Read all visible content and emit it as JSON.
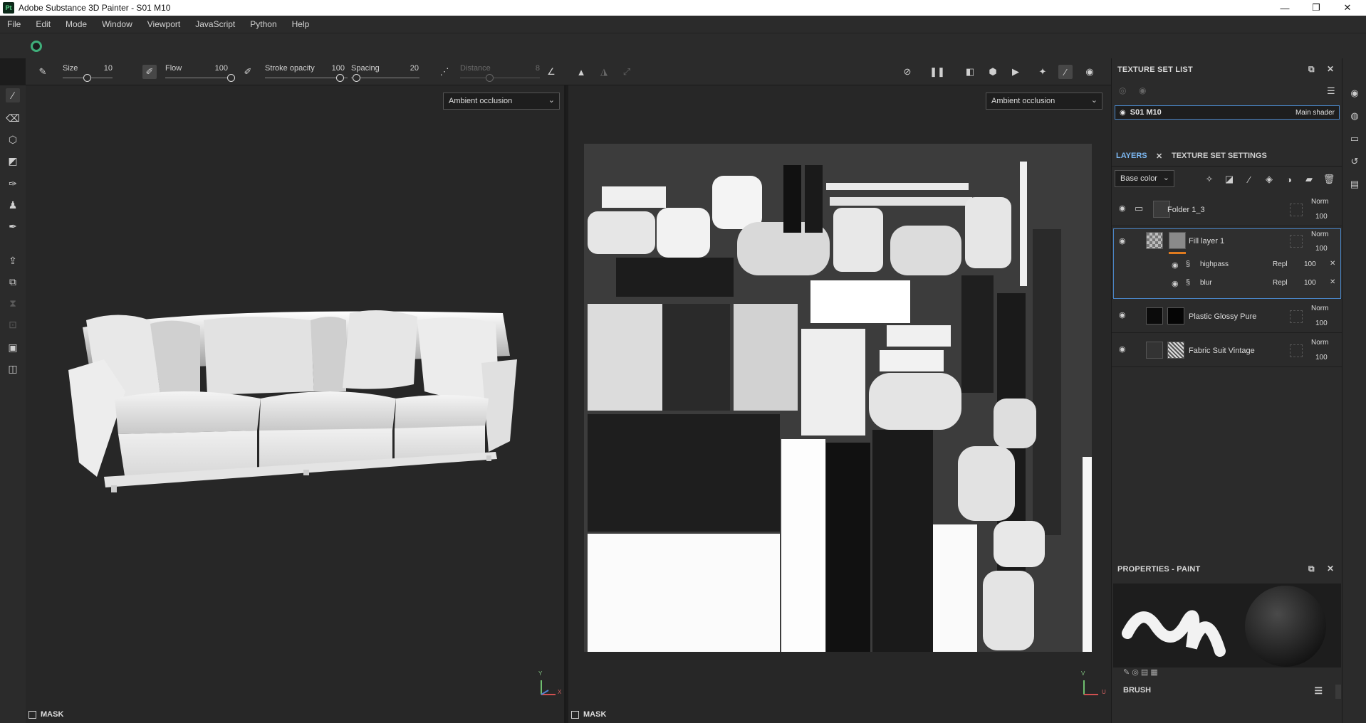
{
  "titlebar": {
    "logo": "Pt",
    "title": "Adobe Substance 3D Painter - S01 M10",
    "minimize": "—",
    "maximize": "❐",
    "close": "✕"
  },
  "menu": [
    "File",
    "Edit",
    "Mode",
    "Window",
    "Viewport",
    "JavaScript",
    "Python",
    "Help"
  ],
  "toolbar": {
    "size_label": "Size",
    "size_value": "10",
    "flow_label": "Flow",
    "flow_value": "100",
    "stroke_opacity_label": "Stroke opacity",
    "stroke_opacity_value": "100",
    "spacing_label": "Spacing",
    "spacing_value": "20",
    "distance_label": "Distance",
    "distance_value": "8"
  },
  "viewport3d": {
    "channel_dropdown": "Ambient occlusion",
    "mask_label": "MASK",
    "axis_y": "Y",
    "axis_x": "X"
  },
  "viewport2d": {
    "channel_dropdown": "Ambient occlusion",
    "mask_label": "MASK",
    "axis_v": "V",
    "axis_u": "U"
  },
  "texture_set_list": {
    "title": "TEXTURE SET LIST",
    "item_name": "S01 M10",
    "item_shader": "Main shader"
  },
  "layers_panel": {
    "tab_layers": "LAYERS",
    "tab_texture_set_settings": "TEXTURE SET SETTINGS",
    "channel_select": "Base color",
    "layers": [
      {
        "name": "Folder 1_3",
        "blend": "Norm",
        "opacity": "100"
      },
      {
        "name": "Fill layer 1",
        "blend": "Norm",
        "opacity": "100"
      },
      {
        "name": "highpass",
        "blend": "Repl",
        "opacity": "100"
      },
      {
        "name": "blur",
        "blend": "Repl",
        "opacity": "100"
      },
      {
        "name": "Plastic Glossy Pure",
        "blend": "Norm",
        "opacity": "100"
      },
      {
        "name": "Fabric Suit Vintage",
        "blend": "Norm",
        "opacity": "100"
      }
    ]
  },
  "properties": {
    "title": "PROPERTIES - PAINT",
    "brush_section": "BRUSH"
  },
  "colors": {
    "accent_blue": "#7cb8f2",
    "selection_border": "#4a86c8",
    "layer_orange": "#e07b1f",
    "logo_green": "#3fae7a"
  }
}
